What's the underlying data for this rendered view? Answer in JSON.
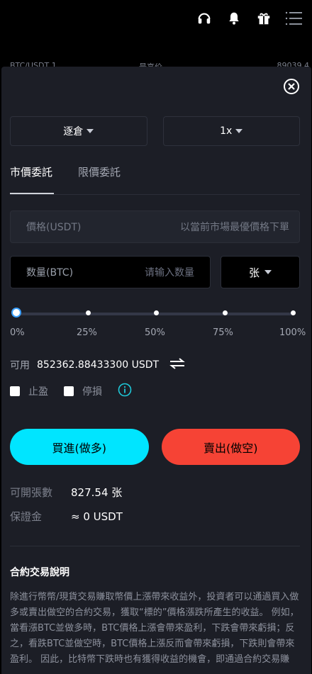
{
  "topbar": {
    "icons": [
      "headset-icon",
      "bell-icon",
      "gift-icon",
      "menu-icon"
    ],
    "behind_row": {
      "left": "BTC/USDT 1",
      "center": "最高价",
      "right": "89039.4"
    }
  },
  "sheet": {
    "close_icon": "close-icon",
    "margin_mode": {
      "label": "逐倉"
    },
    "leverage": {
      "label": "1x"
    },
    "tabs": [
      {
        "label": "市價委託",
        "active": true
      },
      {
        "label": "限價委託",
        "active": false
      }
    ],
    "price_field": {
      "label": "價格(USDT)",
      "placeholder": "以當前市場最優價格下單"
    },
    "quantity_field": {
      "label": "数量(BTC)",
      "placeholder": "请输入数量"
    },
    "unit_select": {
      "label": "张"
    },
    "slider": {
      "value_percent": 0,
      "labels": [
        "0%",
        "25%",
        "50%",
        "75%",
        "100%"
      ]
    },
    "available": {
      "label": "可用",
      "value": "852362.88433300 USDT",
      "icon": "swap-icon"
    },
    "checks": {
      "take_profit": {
        "label": "止盈",
        "checked": false
      },
      "stop_loss": {
        "label": "停損",
        "checked": false
      },
      "info_icon": "info-icon"
    },
    "buy_button": {
      "label": "買進(做多)"
    },
    "sell_button": {
      "label": "賣出(做空)"
    },
    "openable": {
      "label": "可開張數",
      "value": "827.54 张"
    },
    "margin": {
      "label": "保證金",
      "value": "≈ 0 USDT"
    },
    "explain": {
      "title": "合約交易說明",
      "body": "除進行幣幣/現貨交易賺取幣價上漲帶來收益外，投資者可以通過買入做多或賣出做空的合約交易，獲取“標的”價格漲跌所產生的收益。 例如，當看漲BTC並做多時，BTC價格上漲會帶來盈利，下跌會帶來虧損；反之，看跌BTC並做空時，BTC價格上漲反而會帶來虧損，下跌則會帶來盈利。 因此，比特幣下跌時也有獲得收益的機會，即通過合約交易賺"
    }
  },
  "colors": {
    "buy": "#00e5ff",
    "sell": "#f64335",
    "sheet_bg": "#1c1e26",
    "info": "#1ec8d8"
  }
}
